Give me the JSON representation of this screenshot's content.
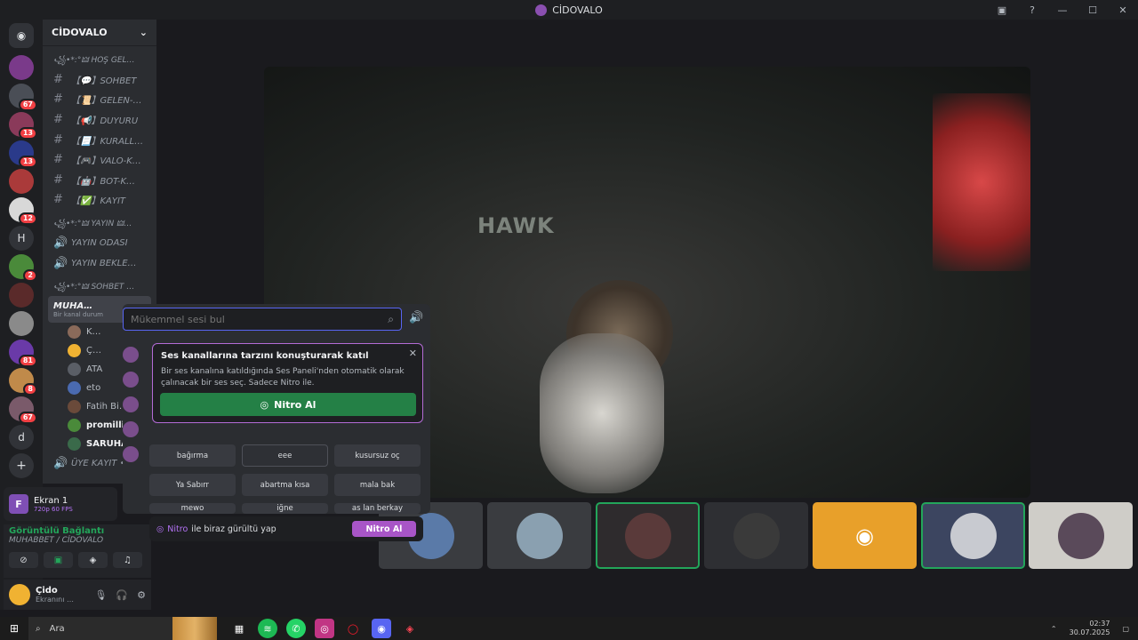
{
  "titlebar": {
    "title": "CİDOVALO"
  },
  "servers": {
    "badges": [
      "67",
      "13",
      "13",
      "12",
      "2",
      "81",
      "8",
      "67"
    ],
    "letters": [
      "H",
      "d"
    ]
  },
  "guild": {
    "name": "CİDOVALO"
  },
  "categories": {
    "c1": "꧁•*:°🜲 HOŞ GEL…",
    "c2": "꧁•*:°🜲 YAYIN 🜲…",
    "c3": "꧁•*:°🜲 SOHBET …",
    "c4": "ÜYE KAYIT •"
  },
  "channels": [
    {
      "label": "【💬】SOHBET"
    },
    {
      "label": "【📜】GELEN-…"
    },
    {
      "label": "【📢】DUYURU"
    },
    {
      "label": "【📃】KURALL…"
    },
    {
      "label": "【🎮】VALO-K…"
    },
    {
      "label": "【🤖】BOT-K…"
    },
    {
      "label": "【✅】KAYIT"
    }
  ],
  "voice_channels": {
    "yayin_odasi": "YAYIN ODASI",
    "yayin_bekle": "YAYIN BEKLE…",
    "muhabbet": "MUHA…",
    "muhabbet_status": "Bir kanal durum"
  },
  "members": [
    "K…",
    "Ç…",
    "ATA",
    "eto",
    "Fatih Bi…",
    "promilli",
    "SARUHA…"
  ],
  "screen_share": {
    "label": "Ekran 1",
    "quality": "720p 60 FPS",
    "letter": "F"
  },
  "voice": {
    "status": "Görüntülü Bağlantı",
    "location": "MUHABBET / CİDOVALO"
  },
  "user": {
    "name": "Çido",
    "status": "Ekranını …"
  },
  "soundboard": {
    "search_placeholder": "Mükemmel sesi bul",
    "promo_title": "Ses kanallarına tarzını konuşturarak katıl",
    "promo_body": "Bir ses kanalına katıldığında Ses Paneli'nden otomatik olarak çalınacak bir ses seç. Sadece Nitro ile.",
    "promo_button": "Nitro Al",
    "sounds_row1": [
      "bağırma",
      "eee",
      "kusursuz oç"
    ],
    "sounds_row2": [
      "Ya Sabırr",
      "abartma kısa",
      "mala bak"
    ],
    "sounds_row3": [
      "mewo",
      "iğne",
      "as lan berkay"
    ]
  },
  "nitrobar": {
    "prefix": "Nitro",
    "text": "ile biraz gürültü yap",
    "button": "Nitro Al"
  },
  "video": {
    "brand": "HAWK"
  },
  "taskbar": {
    "search": "Ara",
    "time": "02:37",
    "date": "30.07.2025"
  },
  "colors": {
    "accent": "#5865f2",
    "green": "#23a55a",
    "nitro": "#a855c7",
    "danger": "#f23f43"
  }
}
